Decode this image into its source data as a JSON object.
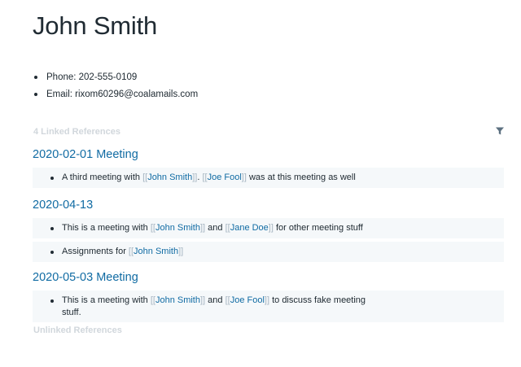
{
  "page": {
    "title": "John Smith"
  },
  "properties": [
    {
      "text": "Phone: 202-555-0109"
    },
    {
      "text": "Email: rixom60296@coalamails.com"
    }
  ],
  "linked_refs": {
    "header": "4 Linked References",
    "filter_icon": "filter-icon",
    "groups": [
      {
        "title": "2020-02-01 Meeting",
        "blocks": [
          {
            "before": "A third meeting with ",
            "link1": "John Smith",
            "middle": ". ",
            "link2": "Joe Fool",
            "after": " was at this meeting as well"
          }
        ]
      },
      {
        "title": "2020-04-13",
        "blocks": [
          {
            "before": "This is a meeting with ",
            "link1": "John Smith",
            "middle": " and ",
            "link2": "Jane Doe",
            "after": " for other meeting stuff"
          },
          {
            "before": "Assignments for ",
            "link1": "John Smith"
          }
        ]
      },
      {
        "title": "2020-05-03 Meeting",
        "blocks": [
          {
            "before": "This is a meeting with ",
            "link1": "John Smith",
            "middle": " and ",
            "link2": "Joe Fool",
            "after": " to discuss fake meeting",
            "line2": "stuff."
          }
        ]
      }
    ]
  },
  "unlinked_refs": {
    "header": "Unlinked References"
  },
  "brackets": {
    "open": "[[",
    "close": "]]"
  },
  "colors": {
    "link": "#106ba3",
    "bracket": "#a7b6c2",
    "block_bg": "#f5f8fa",
    "muted_header": "#d1d7dc"
  }
}
